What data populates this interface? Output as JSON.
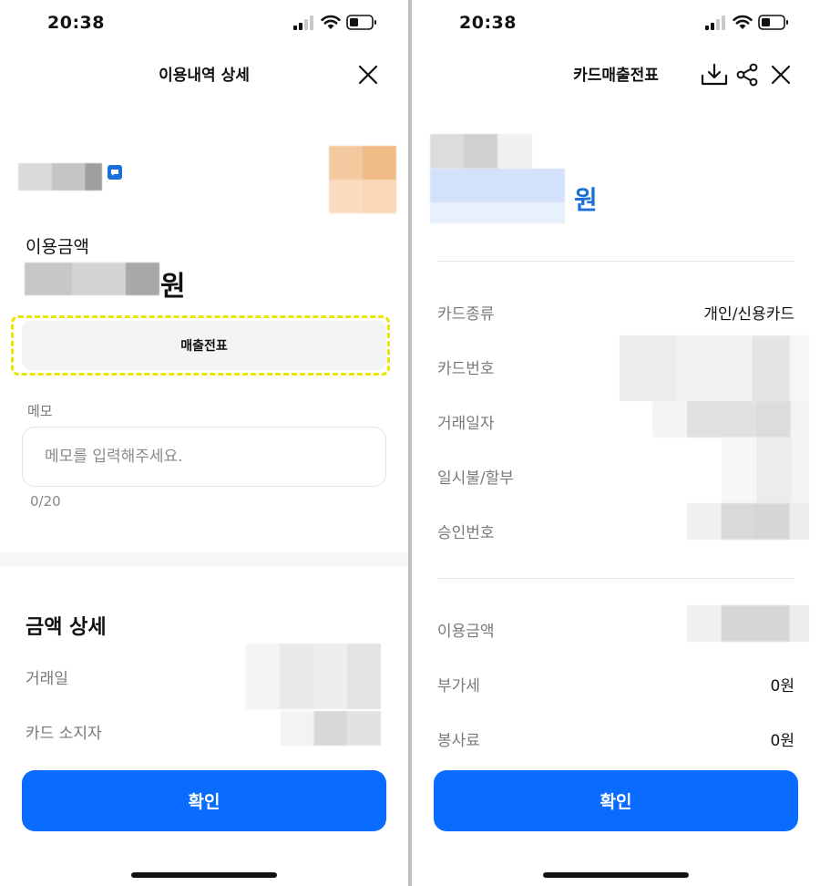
{
  "status_bar": {
    "time": "20:38"
  },
  "left": {
    "title": "이용내역 상세",
    "amount_label": "이용금액",
    "won_unit": "원",
    "receipt_button": "매출전표",
    "memo_label": "메모",
    "memo_placeholder": "메모를 입력해주세요.",
    "memo_count": "0/20",
    "section_title": "금액 상세",
    "detail_rows": [
      "거래일",
      "카드 소지자"
    ],
    "confirm_button": "확인"
  },
  "right": {
    "title": "카드매출전표",
    "won_unit": "원",
    "rows": [
      {
        "label": "카드종류",
        "value": "개인/신용카드"
      },
      {
        "label": "카드번호",
        "value": ""
      },
      {
        "label": "거래일자",
        "value": ""
      },
      {
        "label": "일시불/할부",
        "value": ""
      },
      {
        "label": "승인번호",
        "value": ""
      }
    ],
    "amount_rows": [
      {
        "label": "이용금액",
        "value": ""
      },
      {
        "label": "부가세",
        "value": "0원"
      },
      {
        "label": "봉사료",
        "value": "0원"
      }
    ],
    "confirm_button": "확인"
  },
  "colors": {
    "primary": "#0a6cff",
    "won_blue": "#1a6fd8",
    "highlight": "#e6e600"
  },
  "icons": [
    "close-icon",
    "download-icon",
    "share-icon",
    "message-icon"
  ]
}
